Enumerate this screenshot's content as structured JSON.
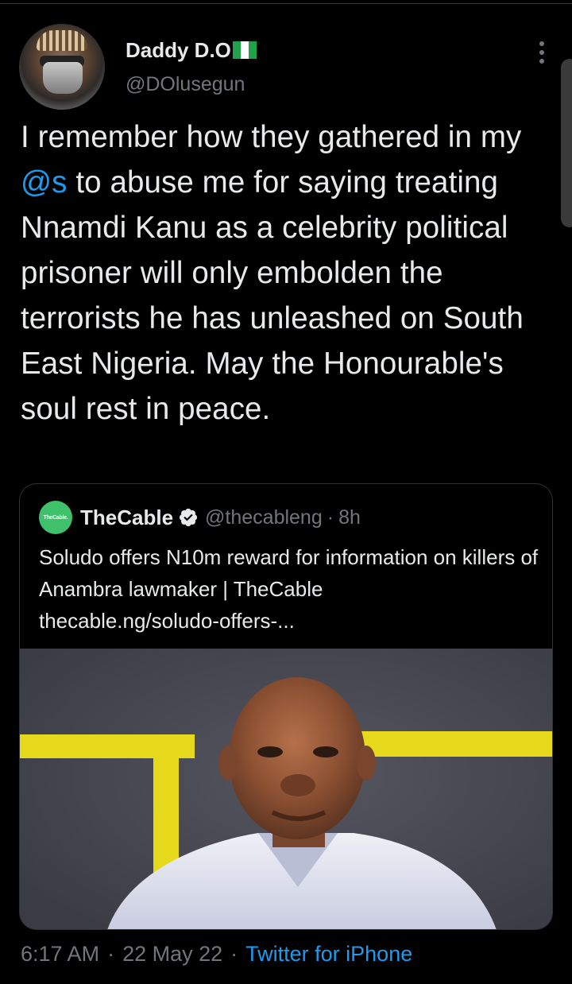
{
  "tweet": {
    "author": {
      "display_name": "Daddy D.O",
      "flag_emoji": "🇳🇬",
      "handle": "@DOlusegun"
    },
    "text_before_mention": "I remember how they gathered in my ",
    "mention": "@s",
    "text_after_mention": " to abuse me for saying treating Nnamdi Kanu as a celebrity political prisoner will only embolden the terrorists he has unleashed on South East Nigeria. May the Honourable's soul rest in peace.",
    "time": "6:17 AM",
    "date": "22 May 22",
    "source": "Twitter for iPhone",
    "separator": "·"
  },
  "quoted_tweet": {
    "avatar_text": "TheCable.",
    "display_name": "TheCable",
    "verified": true,
    "handle": "@thecableng",
    "separator": "·",
    "age": "8h",
    "headline": "Soludo offers N10m reward for information on killers of Anambra lawmaker | TheCable",
    "link": "thecable.ng/soludo-offers-..."
  },
  "colors": {
    "background": "#000000",
    "text": "#e7e9ea",
    "secondary": "#71767b",
    "accent": "#1d9bf0",
    "border": "#2f3336",
    "verified": "#e7e9ea"
  },
  "icons": {
    "more": "more-vertical-icon",
    "verified": "verified-badge-icon",
    "flag": "nigeria-flag-icon"
  }
}
